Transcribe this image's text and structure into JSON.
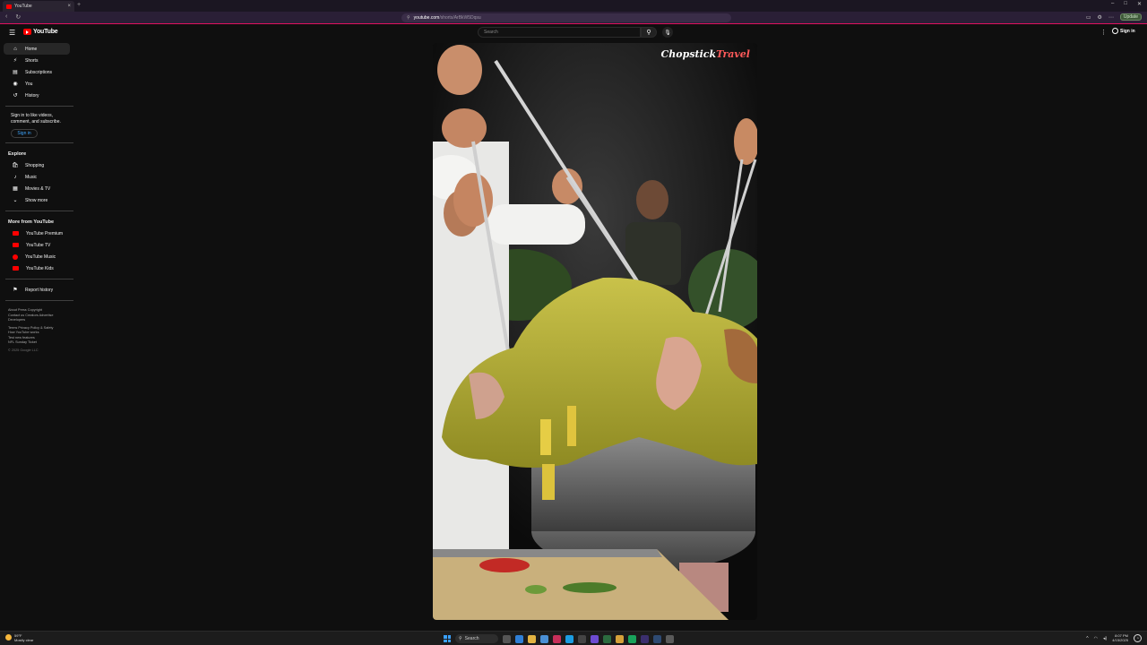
{
  "browser": {
    "tab_title": "YouTube",
    "tab_close": "×",
    "new_tab": "+",
    "url_host": "youtube.com",
    "url_path": "/shorts/ArBkW5Dqsu",
    "update_label": "Update"
  },
  "header": {
    "logo_text": "YouTube",
    "search_placeholder": "Search",
    "signin_label": "Sign in"
  },
  "sidebar": {
    "primary": [
      {
        "label": "Home",
        "icon": "home-icon",
        "glyph": "⌂"
      },
      {
        "label": "Shorts",
        "icon": "shorts-icon",
        "glyph": "⚡"
      },
      {
        "label": "Subscriptions",
        "icon": "subscriptions-icon",
        "glyph": "▤"
      },
      {
        "label": "You",
        "icon": "you-icon",
        "glyph": "◉"
      },
      {
        "label": "History",
        "icon": "history-icon",
        "glyph": "↺"
      }
    ],
    "signin_blurb": "Sign in to like videos, comment, and subscribe.",
    "signin_button": "Sign in",
    "explore_heading": "Explore",
    "explore": [
      {
        "label": "Shopping",
        "icon": "shopping-icon",
        "glyph": "🛍"
      },
      {
        "label": "Music",
        "icon": "music-icon",
        "glyph": "♪"
      },
      {
        "label": "Movies & TV",
        "icon": "movies-icon",
        "glyph": "▦"
      },
      {
        "label": "Show more",
        "icon": "chevron-down-icon",
        "glyph": "⌄"
      }
    ],
    "more_heading": "More from YouTube",
    "more": [
      {
        "label": "YouTube Premium",
        "icon": "youtube-premium-icon"
      },
      {
        "label": "YouTube TV",
        "icon": "youtube-tv-icon"
      },
      {
        "label": "YouTube Music",
        "icon": "youtube-music-icon"
      },
      {
        "label": "YouTube Kids",
        "icon": "youtube-kids-icon"
      }
    ],
    "report": {
      "label": "Report history",
      "icon": "flag-icon",
      "glyph": "⚑"
    },
    "footer_line1": "About  Press  Copyright",
    "footer_line2": "Contact us  Creators  Advertise",
    "footer_line3": "Developers",
    "footer_line4": "Terms  Privacy  Policy & Safety",
    "footer_line5": "How YouTube works",
    "footer_line6": "Test new features",
    "footer_line7": "NFL Sunday Ticket",
    "copyright": "© 2025 Google LLC"
  },
  "video": {
    "watermark_a": "Chopstick",
    "watermark_b": "Travel"
  },
  "taskbar": {
    "weather_temp": "59°F",
    "weather_desc": "Mostly clear",
    "search_label": "Search",
    "time": "8:07 PM",
    "date": "4/15/2025"
  },
  "colors": {
    "accent": "#ff0000",
    "background": "#0f0f0f"
  }
}
